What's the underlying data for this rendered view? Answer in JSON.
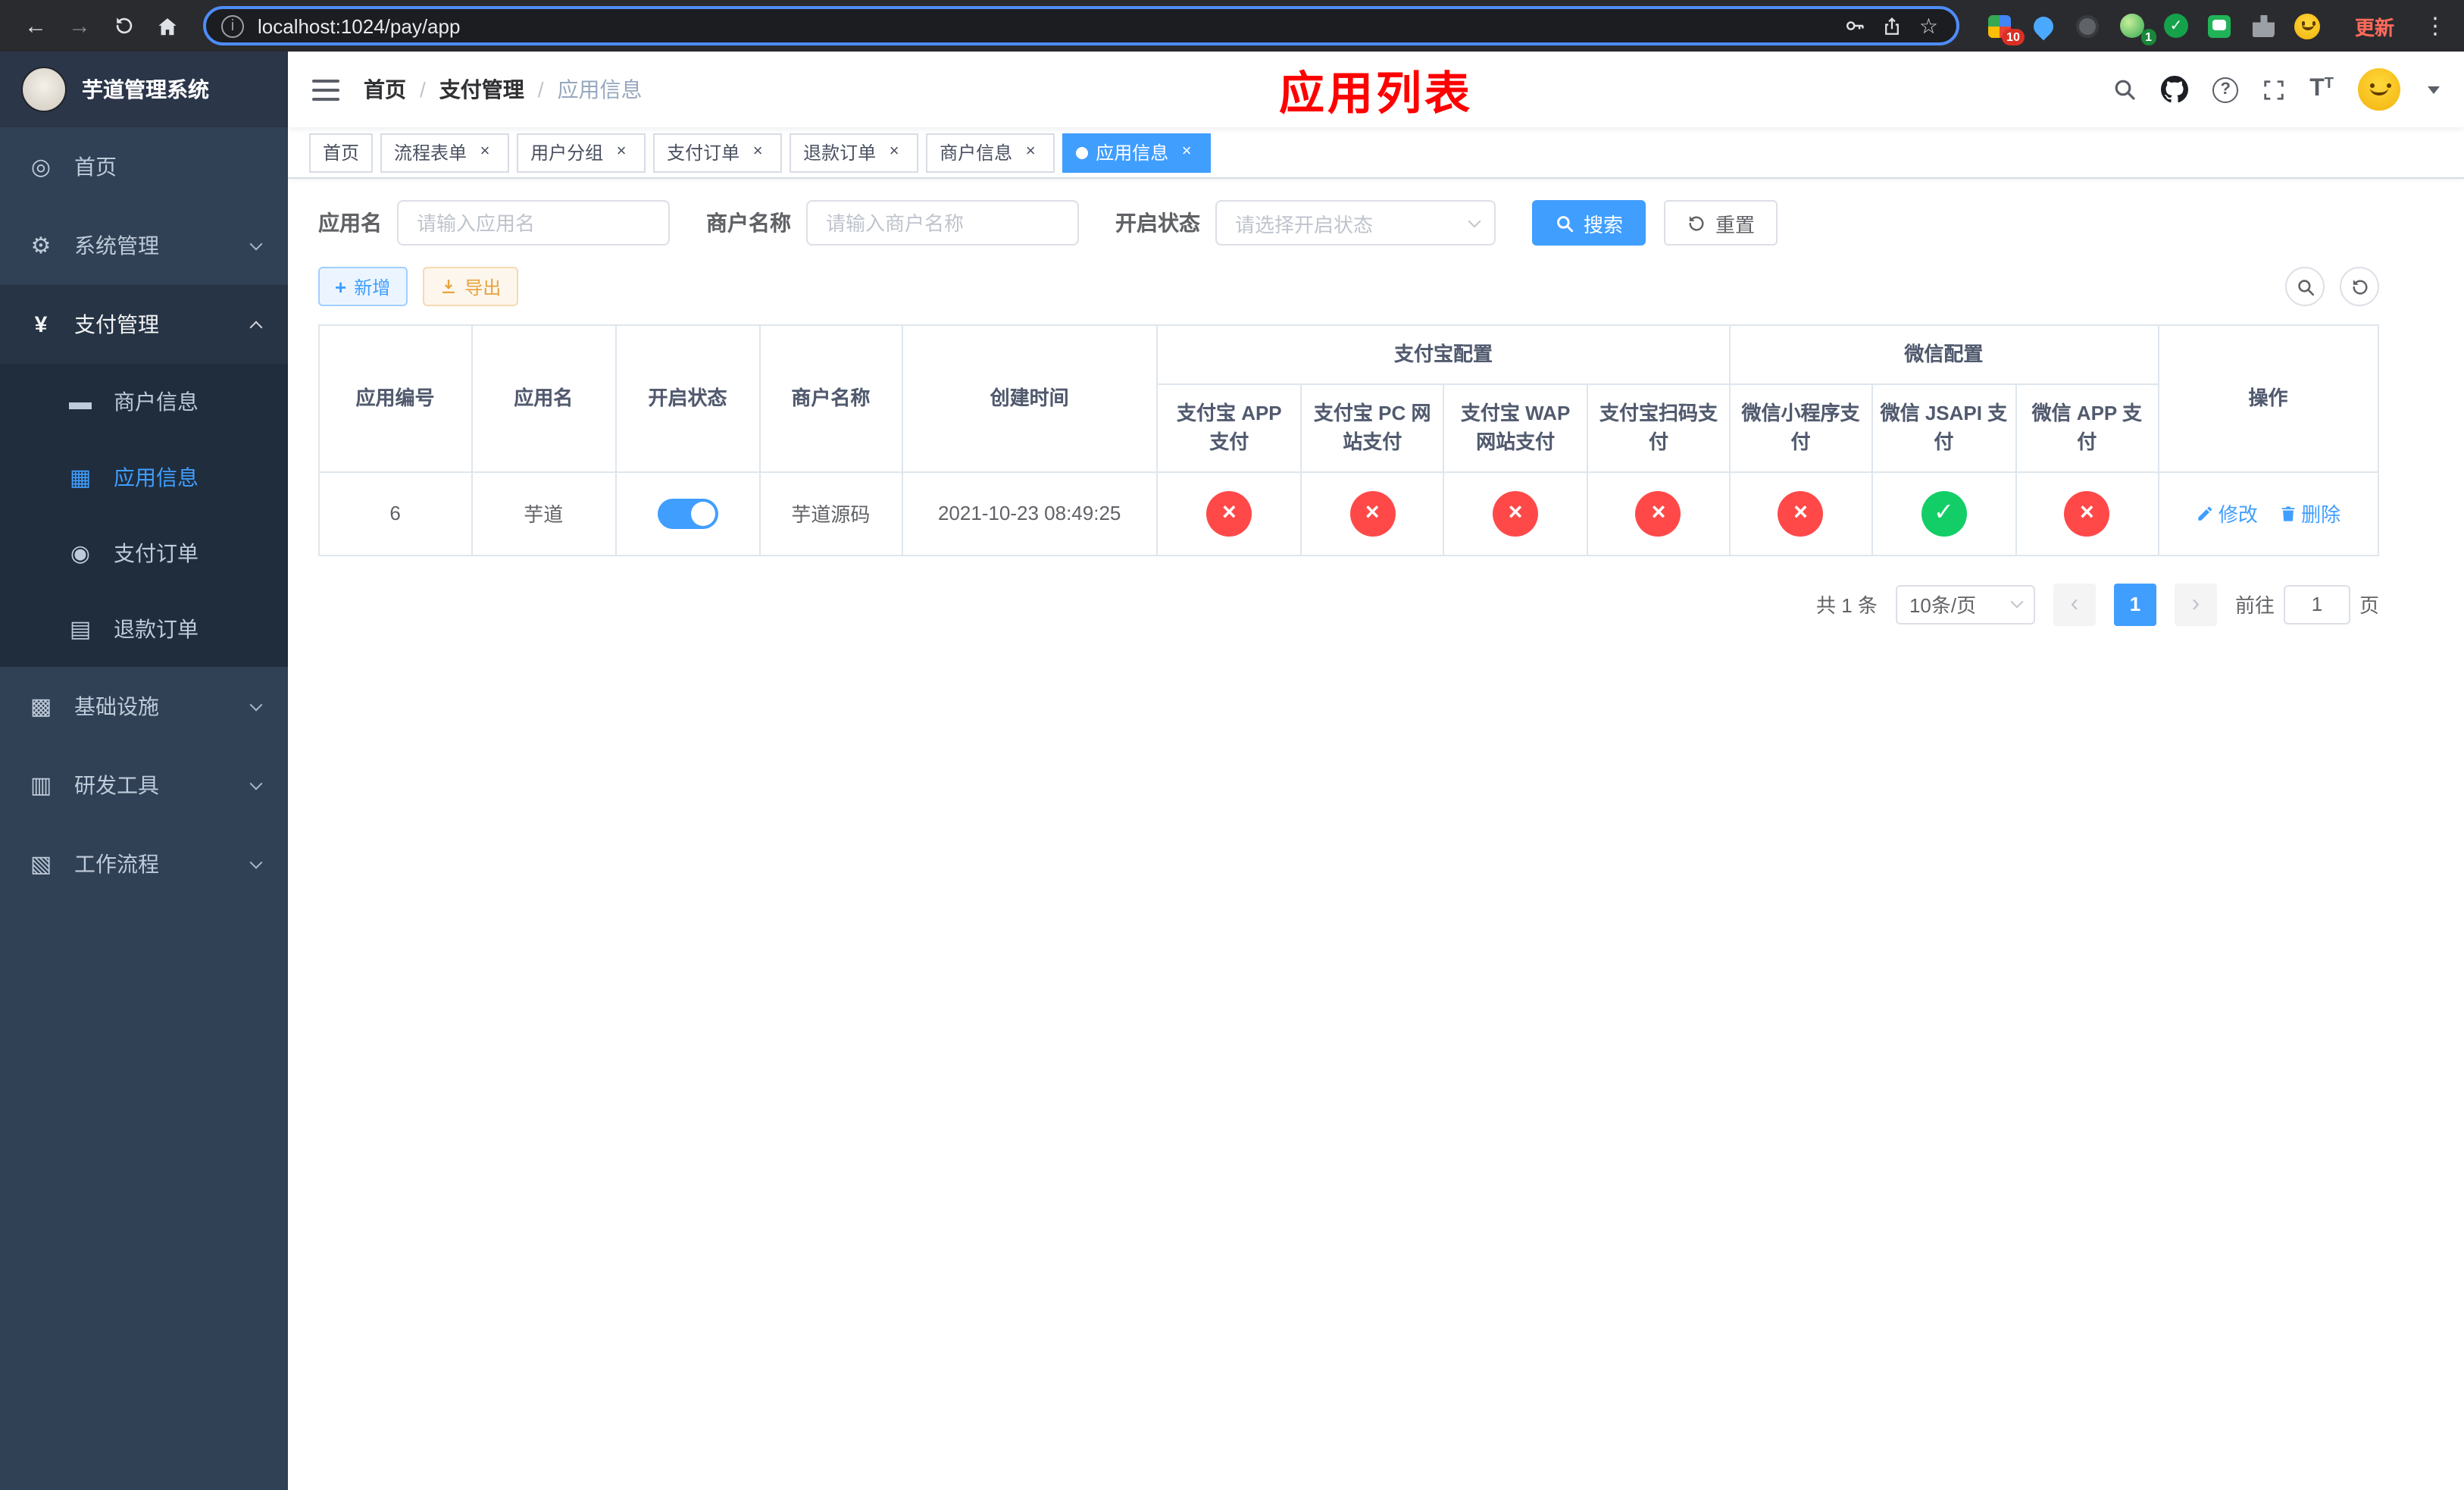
{
  "colors": {
    "accent": "#409eff",
    "success": "#13ce66",
    "fail": "#ff4949",
    "title": "#ff0000"
  },
  "browser": {
    "url": "localhost:1024/pay/app",
    "update_label": "更新",
    "extension_badge": "10",
    "avatar_badge": "1"
  },
  "sidebar": {
    "title": "芋道管理系统",
    "items": [
      {
        "label": "首页"
      },
      {
        "label": "系统管理"
      },
      {
        "label": "支付管理"
      },
      {
        "label": "基础设施"
      },
      {
        "label": "研发工具"
      },
      {
        "label": "工作流程"
      }
    ],
    "payment_children": [
      {
        "label": "商户信息"
      },
      {
        "label": "应用信息"
      },
      {
        "label": "支付订单"
      },
      {
        "label": "退款订单"
      }
    ]
  },
  "header": {
    "breadcrumb": [
      "首页",
      "支付管理",
      "应用信息"
    ],
    "breadcrumb_separator": "/",
    "title": "应用列表"
  },
  "tabs": [
    {
      "label": "首页",
      "closable": false,
      "active": false
    },
    {
      "label": "流程表单",
      "closable": true,
      "active": false
    },
    {
      "label": "用户分组",
      "closable": true,
      "active": false
    },
    {
      "label": "支付订单",
      "closable": true,
      "active": false
    },
    {
      "label": "退款订单",
      "closable": true,
      "active": false
    },
    {
      "label": "商户信息",
      "closable": true,
      "active": false
    },
    {
      "label": "应用信息",
      "closable": true,
      "active": true
    }
  ],
  "filters": {
    "app_name": {
      "label": "应用名",
      "placeholder": "请输入应用名",
      "value": ""
    },
    "merchant_name": {
      "label": "商户名称",
      "placeholder": "请输入商户名称",
      "value": ""
    },
    "status": {
      "label": "开启状态",
      "placeholder": "请选择开启状态",
      "value": ""
    },
    "search_label": "搜索",
    "reset_label": "重置"
  },
  "toolbar": {
    "add_label": "新增",
    "export_label": "导出"
  },
  "table": {
    "group_headers": {
      "alipay": "支付宝配置",
      "wechat": "微信配置"
    },
    "headers": {
      "id": "应用编号",
      "name": "应用名",
      "status": "开启状态",
      "merchant": "商户名称",
      "created": "创建时间",
      "actions": "操作"
    },
    "sub_headers": [
      "支付宝 APP 支付",
      "支付宝 PC 网站支付",
      "支付宝 WAP 网站支付",
      "支付宝扫码支付",
      "微信小程序支付",
      "微信 JSAPI 支付",
      "微信 APP 支付"
    ],
    "row": {
      "id": "6",
      "name": "芋道",
      "enabled": true,
      "merchant": "芋道源码",
      "created": "2021-10-23 08:49:25",
      "statuses": [
        "fail",
        "fail",
        "fail",
        "fail",
        "fail",
        "success",
        "fail"
      ],
      "edit_label": "修改",
      "delete_label": "删除"
    }
  },
  "pagination": {
    "total": "共 1 条",
    "page_size": "10条/页",
    "page": "1",
    "goto_label": "前往",
    "goto_value": "1",
    "unit_label": "页"
  }
}
